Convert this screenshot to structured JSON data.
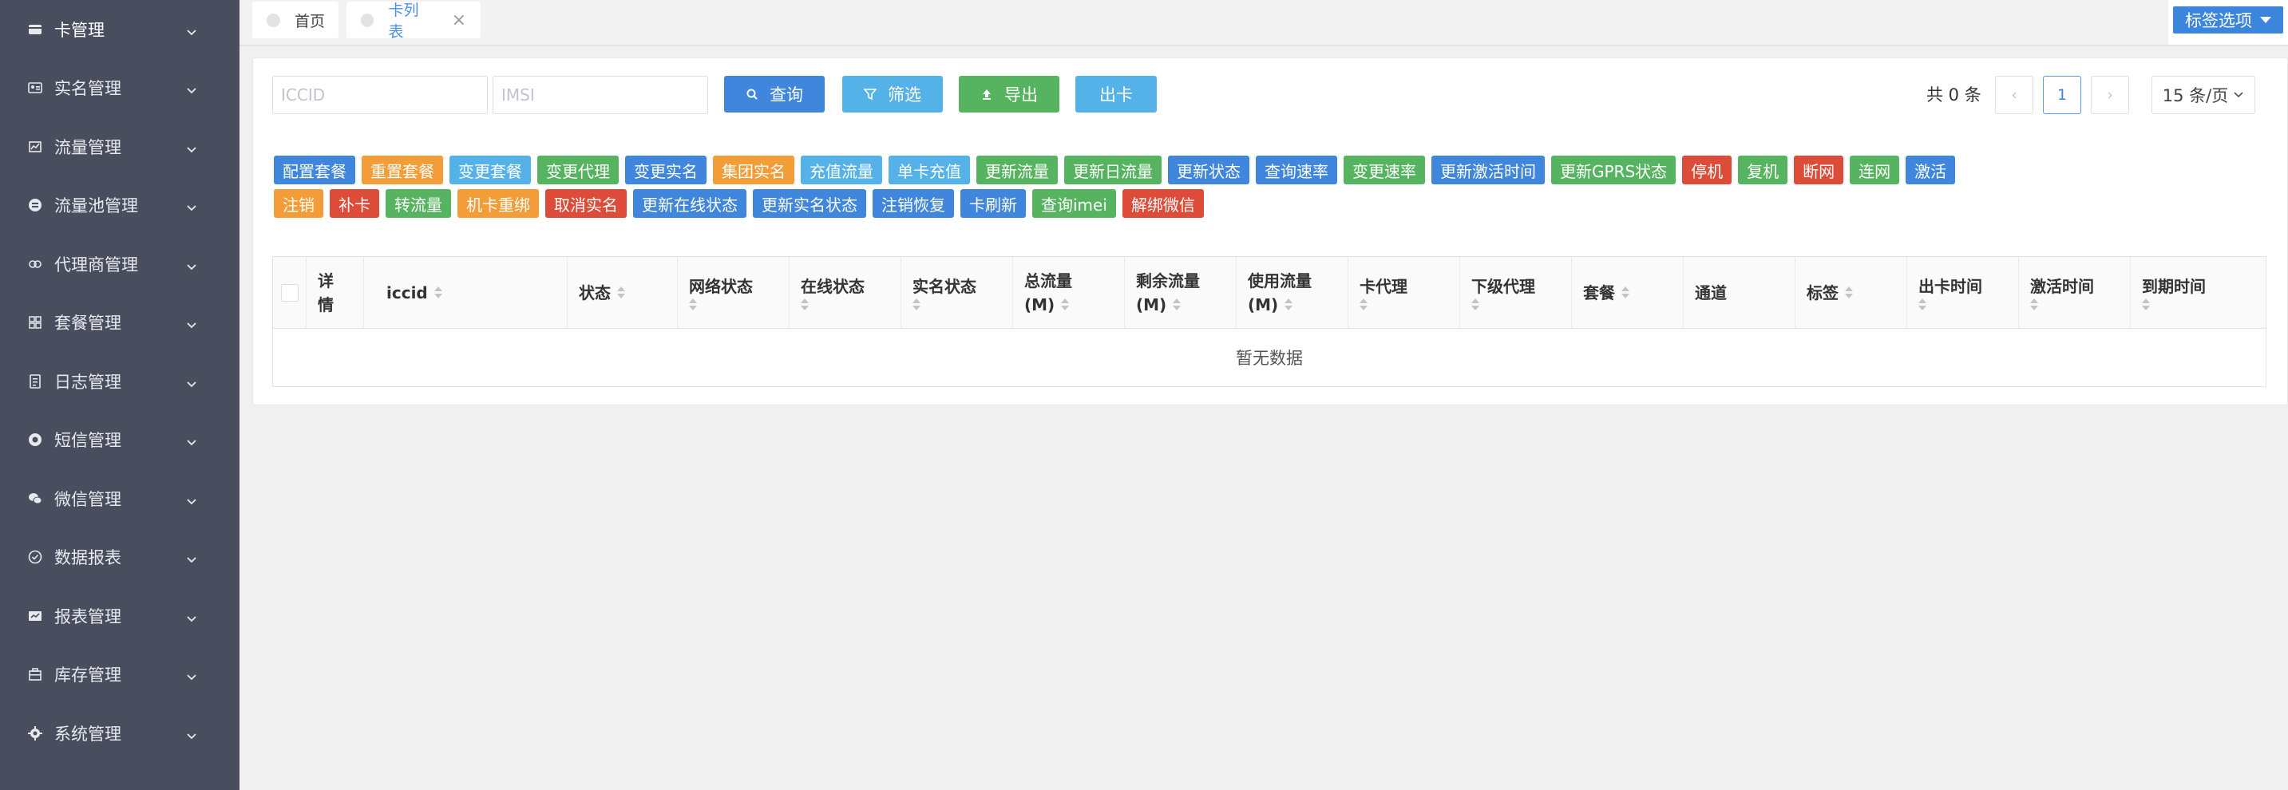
{
  "sidebar": {
    "items": [
      {
        "label": "卡管理",
        "icon": "card-icon"
      },
      {
        "label": "实名管理",
        "icon": "id-card-icon"
      },
      {
        "label": "流量管理",
        "icon": "chart-icon"
      },
      {
        "label": "流量池管理",
        "icon": "database-icon"
      },
      {
        "label": "代理商管理",
        "icon": "agent-icon"
      },
      {
        "label": "套餐管理",
        "icon": "grid-icon"
      },
      {
        "label": "日志管理",
        "icon": "log-icon"
      },
      {
        "label": "短信管理",
        "icon": "message-icon"
      },
      {
        "label": "微信管理",
        "icon": "wechat-icon"
      },
      {
        "label": "数据报表",
        "icon": "report-icon"
      },
      {
        "label": "报表管理",
        "icon": "report-manage-icon"
      },
      {
        "label": "库存管理",
        "icon": "inventory-icon"
      },
      {
        "label": "系统管理",
        "icon": "gear-icon"
      }
    ]
  },
  "tabs": {
    "items": [
      {
        "label": "首页"
      },
      {
        "label": "卡列表",
        "close": "×"
      }
    ],
    "tag_options": "标签选项"
  },
  "toolbar": {
    "iccid_placeholder": "ICCID",
    "imsi_placeholder": "IMSI",
    "query": "查询",
    "filter": "筛选",
    "export": "导出",
    "outcard": "出卡"
  },
  "pager": {
    "total": "共 0 条",
    "current": "1",
    "size": "15 条/页",
    "prev": "‹",
    "next": "›"
  },
  "colors": {
    "blue": "#3f86dc",
    "orange": "#f29d38",
    "cyan": "#55b2e8",
    "green": "#56b461",
    "red": "#dd4b39"
  },
  "actions_row1": [
    {
      "label": "配置套餐",
      "color": "#3f86dc"
    },
    {
      "label": "重置套餐",
      "color": "#f29d38"
    },
    {
      "label": "变更套餐",
      "color": "#55b2e8"
    },
    {
      "label": "变更代理",
      "color": "#56b461"
    },
    {
      "label": "变更实名",
      "color": "#3f86dc"
    },
    {
      "label": "集团实名",
      "color": "#f29d38"
    },
    {
      "label": "充值流量",
      "color": "#55b2e8"
    },
    {
      "label": "单卡充值",
      "color": "#55b2e8"
    },
    {
      "label": "更新流量",
      "color": "#56b461"
    },
    {
      "label": "更新日流量",
      "color": "#56b461"
    },
    {
      "label": "更新状态",
      "color": "#3f86dc"
    },
    {
      "label": "查询速率",
      "color": "#3f86dc"
    },
    {
      "label": "变更速率",
      "color": "#56b461"
    },
    {
      "label": "更新激活时间",
      "color": "#3f86dc"
    },
    {
      "label": "更新GPRS状态",
      "color": "#56b461"
    },
    {
      "label": "停机",
      "color": "#dd4b39"
    },
    {
      "label": "复机",
      "color": "#56b461"
    },
    {
      "label": "断网",
      "color": "#dd4b39"
    },
    {
      "label": "连网",
      "color": "#56b461"
    },
    {
      "label": "激活",
      "color": "#3f86dc"
    }
  ],
  "actions_row2": [
    {
      "label": "注销",
      "color": "#f29d38"
    },
    {
      "label": "补卡",
      "color": "#dd4b39"
    },
    {
      "label": "转流量",
      "color": "#56b461"
    },
    {
      "label": "机卡重绑",
      "color": "#f29d38"
    },
    {
      "label": "取消实名",
      "color": "#dd4b39"
    },
    {
      "label": "更新在线状态",
      "color": "#3f86dc"
    },
    {
      "label": "更新实名状态",
      "color": "#3f86dc"
    },
    {
      "label": "注销恢复",
      "color": "#3f86dc"
    },
    {
      "label": "卡刷新",
      "color": "#3f86dc"
    },
    {
      "label": "查询imei",
      "color": "#56b461"
    },
    {
      "label": "解绑微信",
      "color": "#dd4b39"
    }
  ],
  "table": {
    "columns": [
      {
        "line1": "",
        "line2": "",
        "sortable": false,
        "checkbox": true
      },
      {
        "line1": "详",
        "line2": "情",
        "sortable": false
      },
      {
        "line1": "iccid",
        "line2": "",
        "sortable": true
      },
      {
        "line1": "状态",
        "line2": "",
        "sortable": true
      },
      {
        "line1": "网络状态",
        "line2": "",
        "sortable": true
      },
      {
        "line1": "在线状态",
        "line2": "",
        "sortable": true
      },
      {
        "line1": "实名状态",
        "line2": "",
        "sortable": true
      },
      {
        "line1": "总流量",
        "line2": "(M)",
        "sortable": true
      },
      {
        "line1": "剩余流量",
        "line2": "(M)",
        "sortable": true
      },
      {
        "line1": "使用流量",
        "line2": "(M)",
        "sortable": true
      },
      {
        "line1": "卡代理",
        "line2": "",
        "sortable": true
      },
      {
        "line1": "下级代理",
        "line2": "",
        "sortable": true
      },
      {
        "line1": "套餐",
        "line2": "",
        "sortable": true
      },
      {
        "line1": "通道",
        "line2": "",
        "sortable": false
      },
      {
        "line1": "标签",
        "line2": "",
        "sortable": true
      },
      {
        "line1": "出卡时间",
        "line2": "",
        "sortable": true
      },
      {
        "line1": "激活时间",
        "line2": "",
        "sortable": true
      },
      {
        "line1": "到期时间",
        "line2": "",
        "sortable": true
      }
    ],
    "empty_text": "暂无数据"
  }
}
